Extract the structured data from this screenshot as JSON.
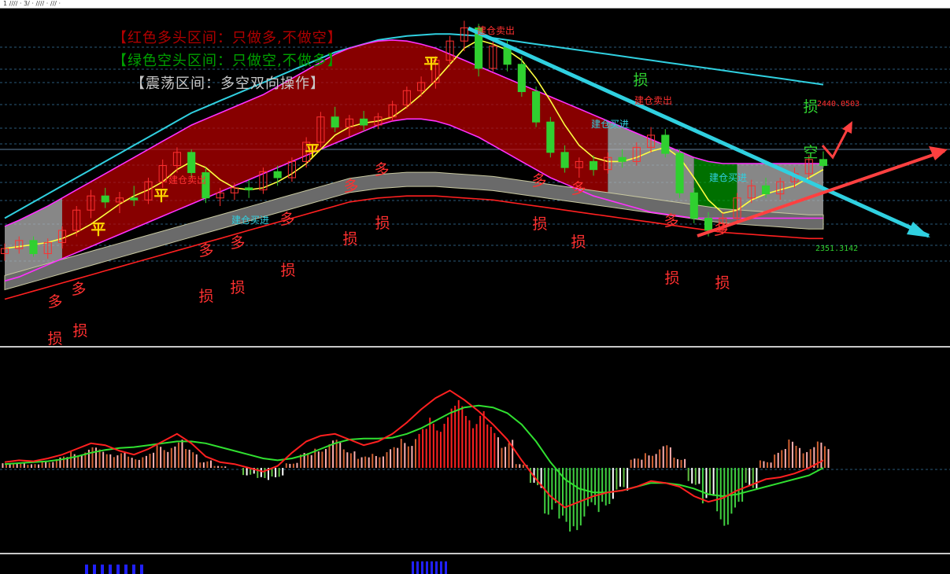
{
  "window": {
    "topbar_text": "1  //// · 3/ ·  //// · /// ·"
  },
  "legend": {
    "bull": "【红色多头区间：只做多,不做空】",
    "bear": "【绿色空头区间：只做空,不做多】",
    "range": "【震荡区间：多空双向操作】"
  },
  "colors": {
    "bull": "#c00000",
    "bear": "#00a000",
    "range": "#b4b4b4",
    "up": "#ff3030",
    "down": "#30d030",
    "cyan": "#30d0e0",
    "magenta": "#ff30ff",
    "yellow": "#ffff40"
  },
  "price_labels": {
    "upper": "2440.0503",
    "lower": "2351.3142"
  },
  "signals": [
    {
      "text": "平",
      "x": 6,
      "y": 1.0,
      "color": "#ffd700"
    },
    {
      "text": "平",
      "x": 11,
      "y": 1.0,
      "color": "#ffd700"
    },
    {
      "text": "平",
      "x": 22,
      "y": 1.0,
      "color": "#ffd700"
    },
    {
      "text": "平",
      "x": 30,
      "y": 1.0,
      "color": "#ffd700"
    },
    {
      "text": "建仓卖出",
      "x": 12,
      "y": 1.0,
      "color": "#ff3030"
    },
    {
      "text": "建仓卖出",
      "x": 33,
      "y": 1.0,
      "color": "#ff3030"
    },
    {
      "text": "建仓卖出",
      "x": 45,
      "y": 1.0,
      "color": "#ff3030"
    },
    {
      "text": "建仓买进",
      "x": 17,
      "y": 0,
      "color": "#30d0e0"
    },
    {
      "text": "建仓买进",
      "x": 42,
      "y": 0,
      "color": "#30d0e0"
    },
    {
      "text": "建仓买进",
      "x": 50,
      "y": 0,
      "color": "#30d0e0"
    },
    {
      "text": "多",
      "x": 3,
      "y": 0,
      "color": "#ff3030"
    },
    {
      "text": "多",
      "x": 5,
      "y": 0,
      "color": "#ff3030"
    },
    {
      "text": "多",
      "x": 14,
      "y": 0,
      "color": "#ff3030"
    },
    {
      "text": "多",
      "x": 16,
      "y": 0,
      "color": "#ff3030"
    },
    {
      "text": "多",
      "x": 20,
      "y": 0,
      "color": "#ff3030"
    },
    {
      "text": "多",
      "x": 24,
      "y": 0,
      "color": "#ff3030"
    },
    {
      "text": "多",
      "x": 27,
      "y": 0,
      "color": "#ff3030"
    },
    {
      "text": "多",
      "x": 38,
      "y": 0,
      "color": "#ff3030"
    },
    {
      "text": "多",
      "x": 40,
      "y": 0,
      "color": "#ff3030"
    },
    {
      "text": "多",
      "x": 47,
      "y": 0,
      "color": "#ff3030"
    },
    {
      "text": "多",
      "x": 51,
      "y": 0,
      "color": "#ff3030"
    },
    {
      "text": "损",
      "x": 3,
      "y": 0,
      "color": "#ff3030"
    },
    {
      "text": "损",
      "x": 5,
      "y": 0,
      "color": "#ff3030"
    },
    {
      "text": "损",
      "x": 14,
      "y": 0,
      "color": "#ff3030"
    },
    {
      "text": "损",
      "x": 16,
      "y": 0,
      "color": "#ff3030"
    },
    {
      "text": "损",
      "x": 20,
      "y": 0,
      "color": "#ff3030"
    },
    {
      "text": "损",
      "x": 24,
      "y": 0,
      "color": "#ff3030"
    },
    {
      "text": "损",
      "x": 27,
      "y": 0,
      "color": "#ff3030"
    },
    {
      "text": "损",
      "x": 38,
      "y": 0,
      "color": "#ff3030"
    },
    {
      "text": "损",
      "x": 40,
      "y": 0,
      "color": "#ff3030"
    },
    {
      "text": "损",
      "x": 47,
      "y": 0,
      "color": "#ff3030"
    },
    {
      "text": "损",
      "x": 51,
      "y": 0,
      "color": "#ff3030"
    },
    {
      "text": "损",
      "x": 45,
      "y": 1,
      "color": "#30d030"
    },
    {
      "text": "损",
      "x": 57,
      "y": 1,
      "color": "#30d030"
    },
    {
      "text": "空",
      "x": 57,
      "y": 1,
      "color": "#30d030"
    }
  ],
  "chart_data": [
    {
      "type": "candlestick",
      "panel": "main",
      "ylim": [
        2260,
        2580
      ],
      "price_ticks": [
        2351.3142,
        2440.0503
      ],
      "zones": [
        {
          "kind": "range",
          "from": 0,
          "to": 4
        },
        {
          "kind": "bull",
          "from": 4,
          "to": 42
        },
        {
          "kind": "range",
          "from": 42,
          "to": 48
        },
        {
          "kind": "bear",
          "from": 48,
          "to": 51
        },
        {
          "kind": "range",
          "from": 51,
          "to": 58
        }
      ],
      "ohlc": [
        [
          2345,
          2355,
          2338,
          2350
        ],
        [
          2350,
          2362,
          2345,
          2358
        ],
        [
          2358,
          2362,
          2342,
          2345
        ],
        [
          2345,
          2360,
          2340,
          2356
        ],
        [
          2356,
          2372,
          2350,
          2368
        ],
        [
          2368,
          2392,
          2362,
          2388
        ],
        [
          2388,
          2408,
          2380,
          2402
        ],
        [
          2402,
          2410,
          2390,
          2396
        ],
        [
          2396,
          2406,
          2385,
          2400
        ],
        [
          2400,
          2412,
          2392,
          2398
        ],
        [
          2398,
          2420,
          2394,
          2416
        ],
        [
          2416,
          2438,
          2410,
          2432
        ],
        [
          2432,
          2450,
          2425,
          2445
        ],
        [
          2445,
          2448,
          2420,
          2425
        ],
        [
          2425,
          2430,
          2395,
          2400
        ],
        [
          2400,
          2410,
          2392,
          2405
        ],
        [
          2405,
          2415,
          2398,
          2410
        ],
        [
          2410,
          2418,
          2400,
          2408
        ],
        [
          2408,
          2430,
          2404,
          2426
        ],
        [
          2426,
          2432,
          2412,
          2420
        ],
        [
          2420,
          2440,
          2416,
          2436
        ],
        [
          2436,
          2460,
          2430,
          2455
        ],
        [
          2455,
          2485,
          2450,
          2480
        ],
        [
          2480,
          2490,
          2465,
          2470
        ],
        [
          2470,
          2482,
          2460,
          2478
        ],
        [
          2478,
          2486,
          2466,
          2472
        ],
        [
          2472,
          2484,
          2468,
          2480
        ],
        [
          2480,
          2496,
          2476,
          2492
        ],
        [
          2492,
          2510,
          2488,
          2506
        ],
        [
          2506,
          2520,
          2500,
          2514
        ],
        [
          2514,
          2540,
          2508,
          2536
        ],
        [
          2536,
          2560,
          2530,
          2555
        ],
        [
          2555,
          2575,
          2545,
          2568
        ],
        [
          2568,
          2572,
          2520,
          2528
        ],
        [
          2528,
          2555,
          2525,
          2550
        ],
        [
          2550,
          2556,
          2525,
          2532
        ],
        [
          2532,
          2540,
          2500,
          2505
        ],
        [
          2505,
          2510,
          2470,
          2475
        ],
        [
          2475,
          2480,
          2440,
          2445
        ],
        [
          2445,
          2452,
          2425,
          2430
        ],
        [
          2430,
          2440,
          2420,
          2436
        ],
        [
          2436,
          2442,
          2422,
          2428
        ],
        [
          2428,
          2445,
          2424,
          2440
        ],
        [
          2440,
          2448,
          2430,
          2436
        ],
        [
          2436,
          2455,
          2432,
          2450
        ],
        [
          2450,
          2470,
          2445,
          2462
        ],
        [
          2462,
          2468,
          2440,
          2444
        ],
        [
          2444,
          2448,
          2400,
          2405
        ],
        [
          2405,
          2410,
          2375,
          2380
        ],
        [
          2380,
          2386,
          2362,
          2368
        ],
        [
          2368,
          2385,
          2364,
          2380
        ],
        [
          2380,
          2405,
          2376,
          2400
        ],
        [
          2400,
          2418,
          2395,
          2412
        ],
        [
          2412,
          2420,
          2400,
          2404
        ],
        [
          2404,
          2420,
          2398,
          2416
        ],
        [
          2416,
          2430,
          2410,
          2424
        ],
        [
          2424,
          2442,
          2418,
          2438
        ],
        [
          2438,
          2446,
          2430,
          2432
        ]
      ],
      "lines": [
        {
          "name": "",
          "color": "#30d0e0",
          "values": [
            2380,
            2388,
            2396,
            2404,
            2412,
            2420,
            2428,
            2436,
            2444,
            2452,
            2460,
            2468,
            2476,
            2484,
            2490,
            2496,
            2502,
            2508,
            2514,
            2520,
            2526,
            2532,
            2538,
            2544,
            2548,
            2552,
            2556,
            2558,
            2560,
            2561,
            2562,
            2562,
            2561,
            2560,
            2558,
            2556,
            2554,
            2552,
            2550,
            2548,
            2546,
            2544,
            2542,
            2540,
            2538,
            2536,
            2534,
            2532,
            2530,
            2528,
            2526,
            2524,
            2522,
            2520,
            2518,
            2516,
            2514,
            2512
          ]
        },
        {
          "name": "",
          "color": "#ff30ff",
          "values": [
            2372,
            2378,
            2385,
            2392,
            2400,
            2408,
            2416,
            2424,
            2432,
            2440,
            2448,
            2456,
            2464,
            2472,
            2478,
            2484,
            2490,
            2496,
            2502,
            2510,
            2518,
            2526,
            2534,
            2542,
            2548,
            2552,
            2555,
            2556,
            2555,
            2552,
            2548,
            2542,
            2536,
            2530,
            2524,
            2518,
            2512,
            2506,
            2500,
            2494,
            2488,
            2482,
            2476,
            2470,
            2464,
            2458,
            2452,
            2446,
            2440,
            2436,
            2434,
            2434,
            2434,
            2434,
            2434,
            2434,
            2434,
            2434
          ]
        },
        {
          "name": "",
          "color": "#ff30ff",
          "values": [
            2318,
            2322,
            2328,
            2334,
            2340,
            2346,
            2352,
            2358,
            2364,
            2370,
            2376,
            2382,
            2388,
            2394,
            2400,
            2406,
            2412,
            2418,
            2424,
            2430,
            2436,
            2442,
            2448,
            2454,
            2460,
            2466,
            2472,
            2476,
            2478,
            2478,
            2476,
            2472,
            2466,
            2460,
            2452,
            2444,
            2436,
            2428,
            2420,
            2414,
            2408,
            2402,
            2398,
            2394,
            2390,
            2386,
            2384,
            2382,
            2380,
            2380,
            2380,
            2380,
            2380,
            2380,
            2380,
            2380,
            2380,
            2380
          ]
        },
        {
          "name": "",
          "color": "#ff2020",
          "values": [
            2300,
            2304,
            2308,
            2312,
            2316,
            2320,
            2324,
            2328,
            2332,
            2336,
            2340,
            2344,
            2348,
            2352,
            2356,
            2360,
            2364,
            2368,
            2372,
            2376,
            2380,
            2384,
            2388,
            2392,
            2396,
            2398,
            2400,
            2401,
            2402,
            2402,
            2402,
            2401,
            2400,
            2399,
            2398,
            2396,
            2394,
            2392,
            2390,
            2388,
            2386,
            2384,
            2382,
            2380,
            2378,
            2376,
            2374,
            2372,
            2370,
            2368,
            2366,
            2365,
            2364,
            2363,
            2362,
            2361,
            2360,
            2360
          ]
        },
        {
          "name": "",
          "color": "#ffff40",
          "values": [
            2350,
            2352,
            2354,
            2356,
            2360,
            2366,
            2374,
            2384,
            2394,
            2402,
            2408,
            2416,
            2428,
            2436,
            2430,
            2418,
            2410,
            2408,
            2410,
            2416,
            2424,
            2434,
            2448,
            2462,
            2470,
            2474,
            2476,
            2480,
            2490,
            2502,
            2516,
            2532,
            2548,
            2556,
            2552,
            2546,
            2536,
            2518,
            2496,
            2472,
            2452,
            2440,
            2436,
            2436,
            2440,
            2446,
            2450,
            2440,
            2420,
            2398,
            2385,
            2388,
            2398,
            2404,
            2408,
            2412,
            2420,
            2428
          ]
        }
      ]
    },
    {
      "type": "macd",
      "panel": "sub",
      "ylim": [
        -1,
        1
      ],
      "histogram": [
        0.05,
        0.06,
        0.04,
        0.08,
        0.12,
        0.18,
        0.22,
        0.2,
        0.16,
        0.12,
        0.16,
        0.24,
        0.3,
        0.2,
        0.08,
        0.02,
        0.0,
        -0.08,
        -0.14,
        -0.1,
        0.06,
        0.16,
        0.24,
        0.3,
        0.22,
        0.12,
        0.16,
        0.22,
        0.32,
        0.42,
        0.54,
        0.66,
        0.72,
        0.6,
        0.46,
        0.3,
        0.04,
        -0.22,
        -0.5,
        -0.72,
        -0.66,
        -0.52,
        -0.4,
        -0.28,
        0.1,
        0.18,
        0.24,
        0.12,
        -0.18,
        -0.4,
        -0.62,
        -0.5,
        -0.22,
        0.08,
        0.2,
        0.3,
        0.22,
        0.28
      ],
      "dif": [
        0.06,
        0.08,
        0.07,
        0.1,
        0.14,
        0.2,
        0.26,
        0.24,
        0.18,
        0.14,
        0.2,
        0.28,
        0.36,
        0.26,
        0.12,
        0.06,
        0.04,
        0.0,
        -0.04,
        0.02,
        0.16,
        0.28,
        0.34,
        0.36,
        0.3,
        0.24,
        0.28,
        0.36,
        0.48,
        0.62,
        0.74,
        0.82,
        0.72,
        0.6,
        0.46,
        0.3,
        0.08,
        -0.12,
        -0.3,
        -0.42,
        -0.36,
        -0.3,
        -0.26,
        -0.24,
        -0.2,
        -0.14,
        -0.16,
        -0.2,
        -0.3,
        -0.36,
        -0.32,
        -0.24,
        -0.18,
        -0.12,
        -0.1,
        -0.06,
        0.0,
        0.08
      ],
      "dea": [
        0.04,
        0.05,
        0.06,
        0.07,
        0.09,
        0.12,
        0.16,
        0.19,
        0.21,
        0.22,
        0.24,
        0.26,
        0.28,
        0.28,
        0.26,
        0.22,
        0.18,
        0.14,
        0.1,
        0.08,
        0.1,
        0.14,
        0.2,
        0.26,
        0.3,
        0.31,
        0.31,
        0.32,
        0.36,
        0.42,
        0.5,
        0.58,
        0.64,
        0.66,
        0.64,
        0.58,
        0.46,
        0.28,
        0.06,
        -0.12,
        -0.22,
        -0.26,
        -0.26,
        -0.24,
        -0.2,
        -0.16,
        -0.16,
        -0.18,
        -0.22,
        -0.28,
        -0.3,
        -0.28,
        -0.24,
        -0.2,
        -0.16,
        -0.12,
        -0.08,
        0.0
      ]
    }
  ]
}
